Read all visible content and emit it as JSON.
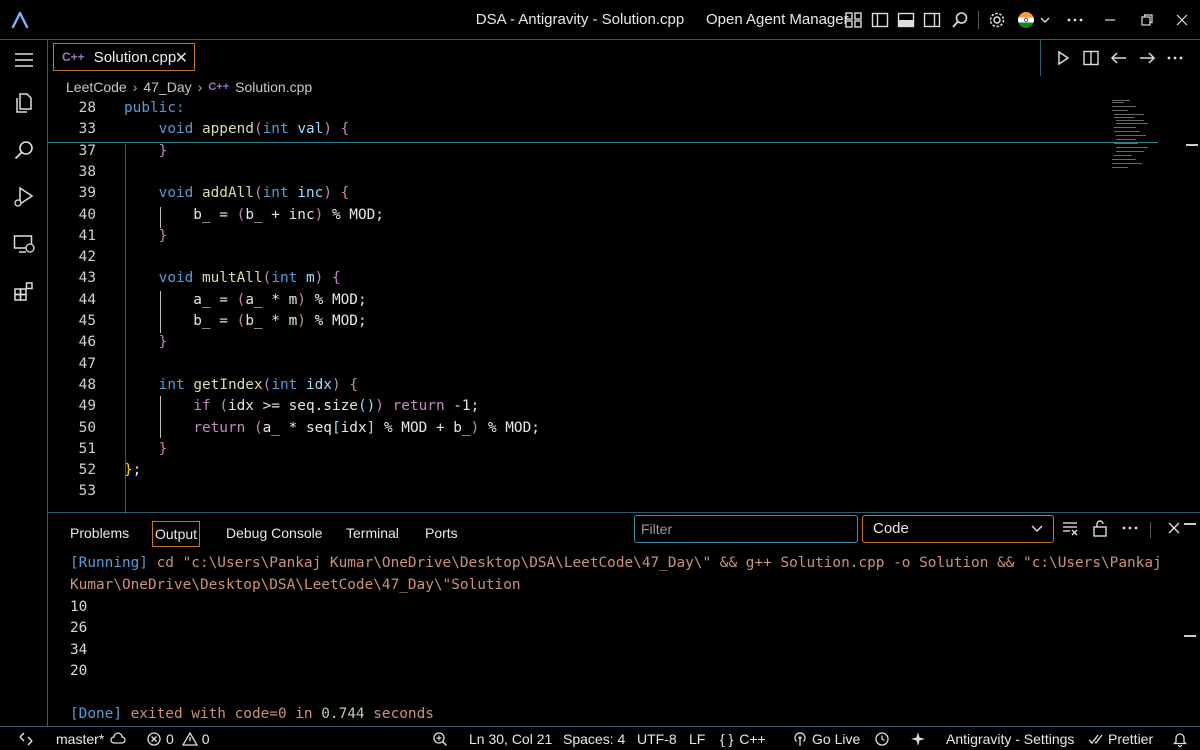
{
  "window": {
    "title": "DSA - Antigravity - Solution.cpp",
    "agent_manager_label": "Open Agent Manager"
  },
  "editor": {
    "tab_label": "Solution.cpp",
    "tab_icon_text": "C++",
    "breadcrumb": {
      "items": [
        "LeetCode",
        "47_Day",
        "Solution.cpp"
      ]
    },
    "lines": [
      {
        "num": "28",
        "tokens": [
          {
            "t": "public:",
            "c": "kw"
          }
        ]
      },
      {
        "num": "33",
        "tokens": [
          {
            "t": "    ",
            "c": "tx"
          },
          {
            "t": "void",
            "c": "kw"
          },
          {
            "t": " ",
            "c": "tx"
          },
          {
            "t": "append",
            "c": "fn"
          },
          {
            "t": "(",
            "c": "pn"
          },
          {
            "t": "int",
            "c": "kw"
          },
          {
            "t": " ",
            "c": "tx"
          },
          {
            "t": "val",
            "c": "pr"
          },
          {
            "t": ")",
            "c": "pn"
          },
          {
            "t": " ",
            "c": "tx"
          },
          {
            "t": "{",
            "c": "pn"
          }
        ]
      },
      {
        "num": "37",
        "tokens": [
          {
            "t": "    ",
            "c": "tx"
          },
          {
            "t": "}",
            "c": "pn"
          }
        ]
      },
      {
        "num": "38",
        "tokens": []
      },
      {
        "num": "39",
        "tokens": [
          {
            "t": "    ",
            "c": "tx"
          },
          {
            "t": "void",
            "c": "kw"
          },
          {
            "t": " ",
            "c": "tx"
          },
          {
            "t": "addAll",
            "c": "fn"
          },
          {
            "t": "(",
            "c": "pn"
          },
          {
            "t": "int",
            "c": "kw"
          },
          {
            "t": " ",
            "c": "tx"
          },
          {
            "t": "inc",
            "c": "pr"
          },
          {
            "t": ")",
            "c": "pn"
          },
          {
            "t": " ",
            "c": "tx"
          },
          {
            "t": "{",
            "c": "pn"
          }
        ]
      },
      {
        "num": "40",
        "tokens": [
          {
            "t": "        b_ = ",
            "c": "tx"
          },
          {
            "t": "(",
            "c": "pn"
          },
          {
            "t": "b_ + inc",
            "c": "tx"
          },
          {
            "t": ")",
            "c": "pn"
          },
          {
            "t": " % MOD;",
            "c": "tx"
          }
        ]
      },
      {
        "num": "41",
        "tokens": [
          {
            "t": "    ",
            "c": "tx"
          },
          {
            "t": "}",
            "c": "pn"
          }
        ]
      },
      {
        "num": "42",
        "tokens": []
      },
      {
        "num": "43",
        "tokens": [
          {
            "t": "    ",
            "c": "tx"
          },
          {
            "t": "void",
            "c": "kw"
          },
          {
            "t": " ",
            "c": "tx"
          },
          {
            "t": "multAll",
            "c": "fn"
          },
          {
            "t": "(",
            "c": "pn"
          },
          {
            "t": "int",
            "c": "kw"
          },
          {
            "t": " ",
            "c": "tx"
          },
          {
            "t": "m",
            "c": "pr"
          },
          {
            "t": ")",
            "c": "pn"
          },
          {
            "t": " ",
            "c": "tx"
          },
          {
            "t": "{",
            "c": "pn"
          }
        ]
      },
      {
        "num": "44",
        "tokens": [
          {
            "t": "        a_ = ",
            "c": "tx"
          },
          {
            "t": "(",
            "c": "pn"
          },
          {
            "t": "a_ * m",
            "c": "tx"
          },
          {
            "t": ")",
            "c": "pn"
          },
          {
            "t": " % MOD;",
            "c": "tx"
          }
        ]
      },
      {
        "num": "45",
        "tokens": [
          {
            "t": "        b_ = ",
            "c": "tx"
          },
          {
            "t": "(",
            "c": "pn"
          },
          {
            "t": "b_ * m",
            "c": "tx"
          },
          {
            "t": ")",
            "c": "pn"
          },
          {
            "t": " % MOD;",
            "c": "tx"
          }
        ]
      },
      {
        "num": "46",
        "tokens": [
          {
            "t": "    ",
            "c": "tx"
          },
          {
            "t": "}",
            "c": "pn"
          }
        ]
      },
      {
        "num": "47",
        "tokens": []
      },
      {
        "num": "48",
        "tokens": [
          {
            "t": "    ",
            "c": "tx"
          },
          {
            "t": "int",
            "c": "kw"
          },
          {
            "t": " ",
            "c": "tx"
          },
          {
            "t": "getIndex",
            "c": "fn"
          },
          {
            "t": "(",
            "c": "pn"
          },
          {
            "t": "int",
            "c": "kw"
          },
          {
            "t": " ",
            "c": "tx"
          },
          {
            "t": "idx",
            "c": "pr"
          },
          {
            "t": ")",
            "c": "pn"
          },
          {
            "t": " ",
            "c": "tx"
          },
          {
            "t": "{",
            "c": "pn"
          }
        ]
      },
      {
        "num": "49",
        "tokens": [
          {
            "t": "        ",
            "c": "tx"
          },
          {
            "t": "if",
            "c": "pn"
          },
          {
            "t": " ",
            "c": "tx"
          },
          {
            "t": "(",
            "c": "pn"
          },
          {
            "t": "idx >= seq.size",
            "c": "tx"
          },
          {
            "t": "()",
            "c": "pr"
          },
          {
            "t": ")",
            "c": "pn"
          },
          {
            "t": " ",
            "c": "tx"
          },
          {
            "t": "return",
            "c": "pn"
          },
          {
            "t": " -1;",
            "c": "tx"
          }
        ]
      },
      {
        "num": "50",
        "tokens": [
          {
            "t": "        ",
            "c": "tx"
          },
          {
            "t": "return",
            "c": "pn"
          },
          {
            "t": " ",
            "c": "tx"
          },
          {
            "t": "(",
            "c": "pn"
          },
          {
            "t": "a_ * seq",
            "c": "tx"
          },
          {
            "t": "[",
            "c": "pr"
          },
          {
            "t": "idx",
            "c": "tx"
          },
          {
            "t": "]",
            "c": "pr"
          },
          {
            "t": " % MOD + b_",
            "c": "tx"
          },
          {
            "t": ")",
            "c": "pn"
          },
          {
            "t": " % MOD;",
            "c": "tx"
          }
        ]
      },
      {
        "num": "51",
        "tokens": [
          {
            "t": "    ",
            "c": "tx"
          },
          {
            "t": "}",
            "c": "pn"
          }
        ]
      },
      {
        "num": "52",
        "tokens": [
          {
            "t": "}",
            "c": "br1"
          },
          {
            "t": ";",
            "c": "tx"
          }
        ]
      },
      {
        "num": "53",
        "tokens": []
      }
    ]
  },
  "panel": {
    "tabs": [
      "Problems",
      "Output",
      "Debug Console",
      "Terminal",
      "Ports"
    ],
    "active_tab": "Output",
    "filter_placeholder": "Filter",
    "channel_selected": "Code",
    "output": {
      "running_tag": "[Running]",
      "command_line1": " cd \"c:\\Users\\Pankaj Kumar\\OneDrive\\Desktop\\DSA\\LeetCode\\47_Day\\\" && g++ Solution.cpp -o Solution && \"c:\\Users\\Pankaj",
      "command_line2": "Kumar\\OneDrive\\Desktop\\DSA\\LeetCode\\47_Day\\\"Solution",
      "results": [
        "10",
        "26",
        "34",
        "20"
      ],
      "done_tag": "[Done]",
      "done_text1": " exited with ",
      "done_code": "code=0",
      "done_text2": " in ",
      "done_time": "0.744",
      "done_text3": " seconds"
    }
  },
  "statusbar": {
    "branch": "master*",
    "errors": "0",
    "warnings": "0",
    "cursor": "Ln 30, Col 21",
    "spaces": "Spaces: 4",
    "encoding": "UTF-8",
    "eol": "LF",
    "language": "C++",
    "golive": "Go Live",
    "settings": "Antigravity - Settings",
    "prettier": "Prettier"
  },
  "colors": {
    "accent_border": "#c2752c",
    "divider": "#2f5f6f",
    "keyword": "#569cd6",
    "function": "#dcdcaa",
    "param": "#9cdcfe",
    "punct": "#c586c0",
    "string": "#ce9178"
  }
}
